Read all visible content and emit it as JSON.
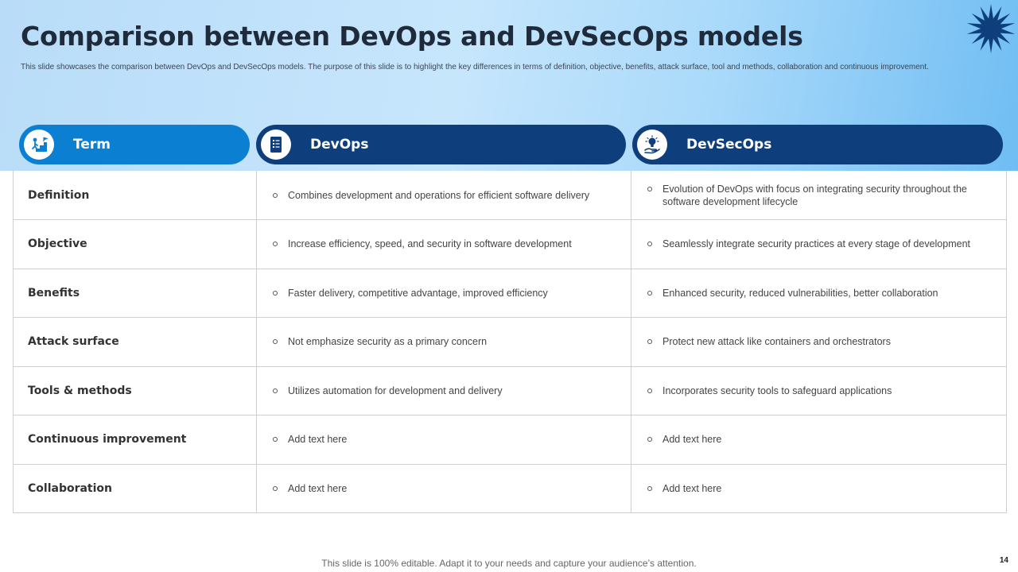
{
  "slide": {
    "title": "Comparison between DevOps and DevSecOps models",
    "subtitle": "This slide showcases the comparison between DevOps and DevSecOps models. The purpose of this slide is to highlight the key differences in terms of definition, objective, benefits, attack surface, tool and methods, collaboration and continuous improvement.",
    "footer": "This slide is 100% editable. Adapt it to your needs and capture your audience’s attention.",
    "page_number": "14"
  },
  "colors": {
    "term_header": "#0b7fd1",
    "model_header": "#0e3f7c",
    "accent_star": "#0e3f7c"
  },
  "headers": {
    "term": {
      "label": "Term",
      "icon": "person-climbing-stairs-icon"
    },
    "devops": {
      "label": "DevOps",
      "icon": "document-list-icon"
    },
    "devsecops": {
      "label": "DevSecOps",
      "icon": "hand-lightbulb-icon"
    }
  },
  "rows": [
    {
      "term": "Definition",
      "devops": "Combines development and operations for efficient software delivery",
      "devsecops": "Evolution of DevOps with focus on integrating security throughout the software development lifecycle"
    },
    {
      "term": "Objective",
      "devops": "Increase efficiency, speed, and security in software development",
      "devsecops": "Seamlessly integrate security practices at every stage of development"
    },
    {
      "term": "Benefits",
      "devops": "Faster delivery, competitive advantage, improved efficiency",
      "devsecops": "Enhanced security, reduced vulnerabilities, better collaboration"
    },
    {
      "term": "Attack surface",
      "devops": "Not emphasize security as a primary concern",
      "devsecops": "Protect new attack like containers and orchestrators"
    },
    {
      "term": "Tools & methods",
      "devops": "Utilizes automation for development and delivery",
      "devsecops": "Incorporates security tools to safeguard applications"
    },
    {
      "term": "Continuous improvement",
      "devops": "Add text here",
      "devsecops": "Add text here"
    },
    {
      "term": "Collaboration",
      "devops": "Add text here",
      "devsecops": "Add text here"
    }
  ]
}
